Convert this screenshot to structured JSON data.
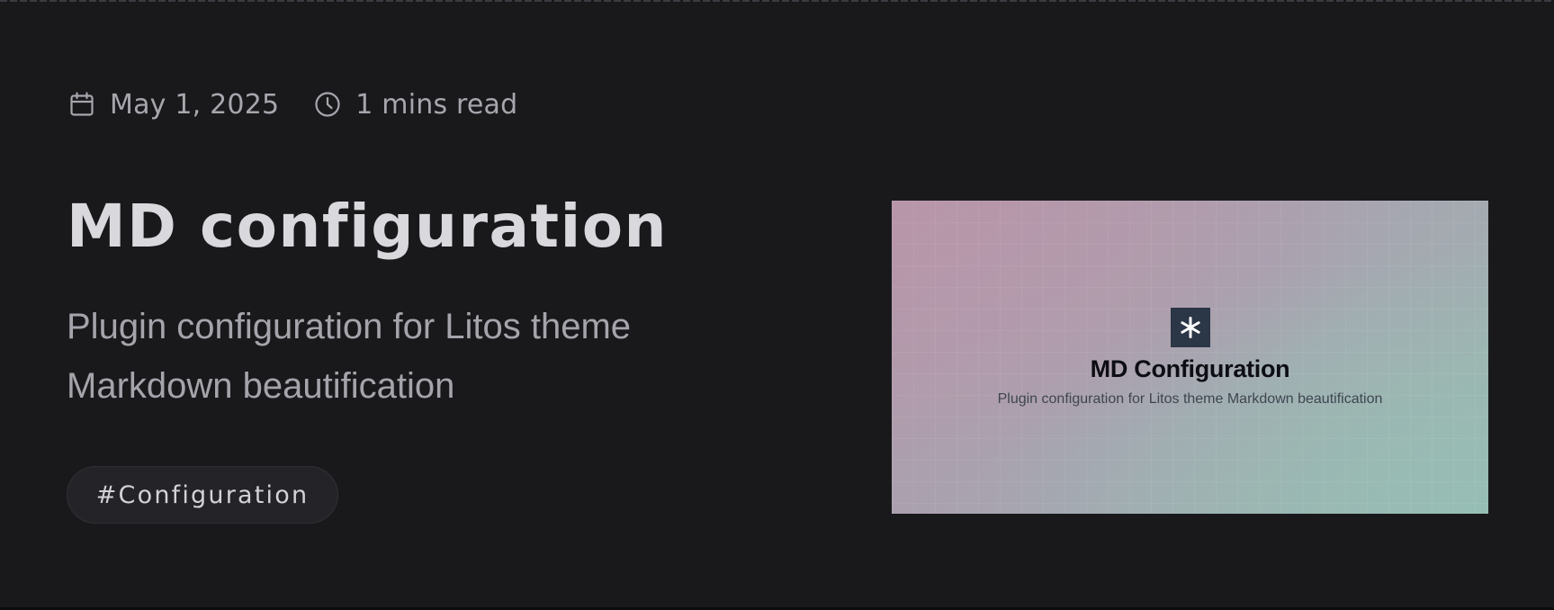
{
  "meta": {
    "date": "May 1, 2025",
    "date_icon": "calendar-icon",
    "read_time": "1 mins read",
    "read_time_icon": "clock-icon"
  },
  "post": {
    "title": "MD configuration",
    "description": "Plugin configuration for Litos theme Markdown beautification",
    "tag": "#Configuration"
  },
  "cover": {
    "logo_icon": "asterisk-logo-icon",
    "title": "MD Configuration",
    "subtitle": "Plugin configuration for Litos theme Markdown beautification"
  },
  "colors": {
    "background": "#19191c",
    "title_text": "#d9d9dd",
    "muted_text": "#a6a6ad",
    "tag_background": "#242428",
    "cover_logo_background": "#2b3646"
  }
}
